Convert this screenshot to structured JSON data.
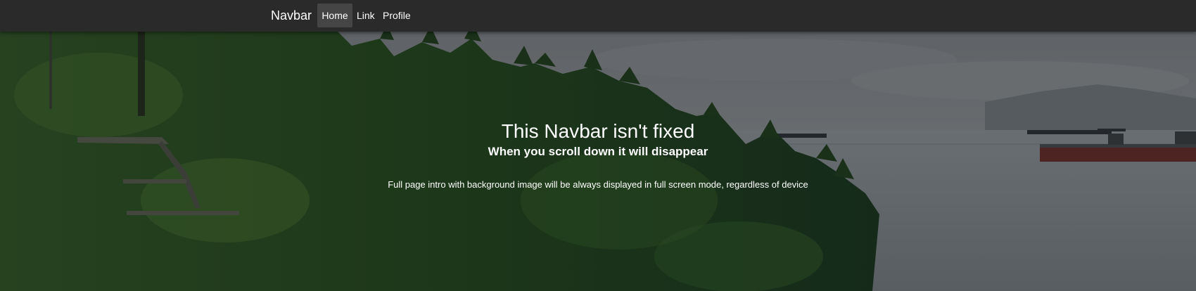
{
  "navbar": {
    "brand": "Navbar",
    "items": [
      {
        "label": "Home",
        "active": true
      },
      {
        "label": "Link",
        "active": false
      },
      {
        "label": "Profile",
        "active": false
      }
    ]
  },
  "hero": {
    "title": "This Navbar isn't fixed",
    "subtitle": "When you scroll down it will disappear",
    "description": "Full page intro with background image will be always displayed in full screen mode, regardless of device"
  },
  "colors": {
    "navbar_bg": "#2a2a2a",
    "active_item_bg": "#454545",
    "text": "#ffffff"
  }
}
